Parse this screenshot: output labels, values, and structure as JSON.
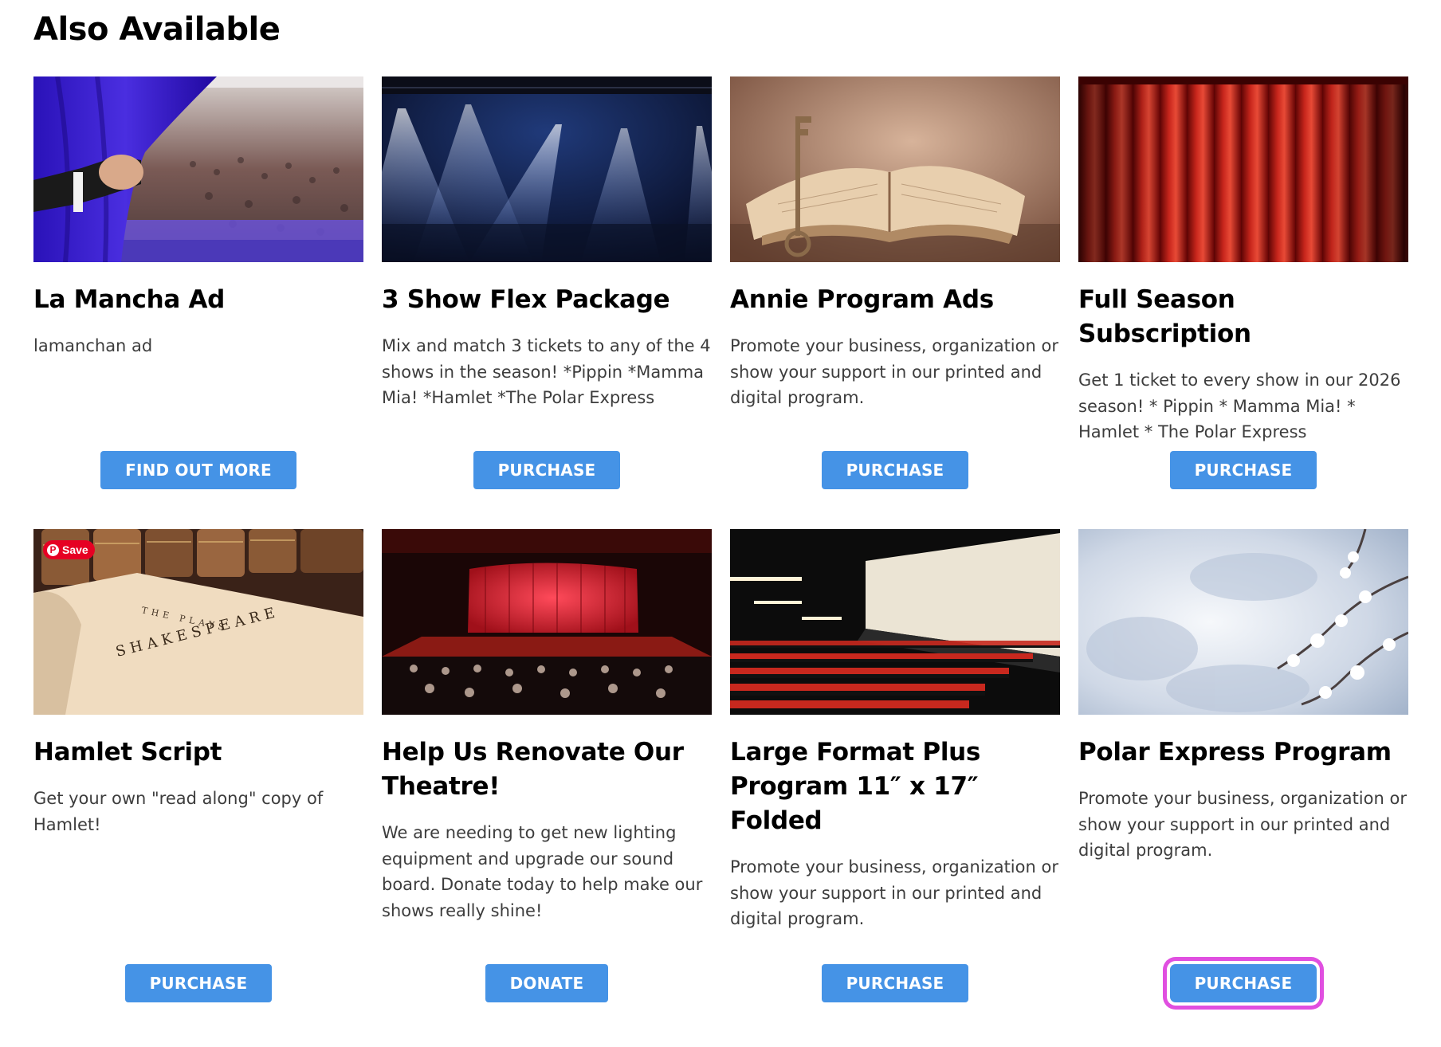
{
  "section": {
    "title": "Also Available"
  },
  "cards": [
    {
      "title": "La Mancha Ad",
      "description": "lamanchan ad",
      "button": "FIND OUT MORE"
    },
    {
      "title": "3 Show Flex Package",
      "description": "Mix and match 3 tickets to any of the 4 shows in the season! *Pippin *Mamma Mia! *Hamlet *The Polar Express",
      "button": "PURCHASE"
    },
    {
      "title": "Annie Program Ads",
      "description": "Promote your business, organization or show your support in our printed and digital program.",
      "button": "PURCHASE"
    },
    {
      "title": "Full Season Subscription",
      "description": "Get 1 ticket to every show in our 2026 season! * Pippin * Mamma Mia! * Hamlet * The Polar Express",
      "button": "PURCHASE"
    },
    {
      "title": "Hamlet Script",
      "description": "Get your own \"read along\" copy of Hamlet!",
      "button": "PURCHASE",
      "save_badge": "Save"
    },
    {
      "title": "Help Us Renovate Our Theatre!",
      "description": "We are needing to get new lighting equipment and upgrade our sound board. Donate today to help make our shows really shine!",
      "button": "DONATE"
    },
    {
      "title": "Large Format Plus Program 11″ x 17″ Folded",
      "description": "Promote your business, organization or show your support in our printed and digital program.",
      "button": "PURCHASE"
    },
    {
      "title": "Polar Express Program",
      "description": "Promote your business, organization or show your support in our printed and digital program.",
      "button": "PURCHASE"
    }
  ],
  "book_text": {
    "line1": "THE PLAYS",
    "line2": "SHAKESPEARE"
  },
  "colors": {
    "button": "#4593e6",
    "focus_ring": "#e04fe0",
    "pinterest": "#e60023"
  }
}
